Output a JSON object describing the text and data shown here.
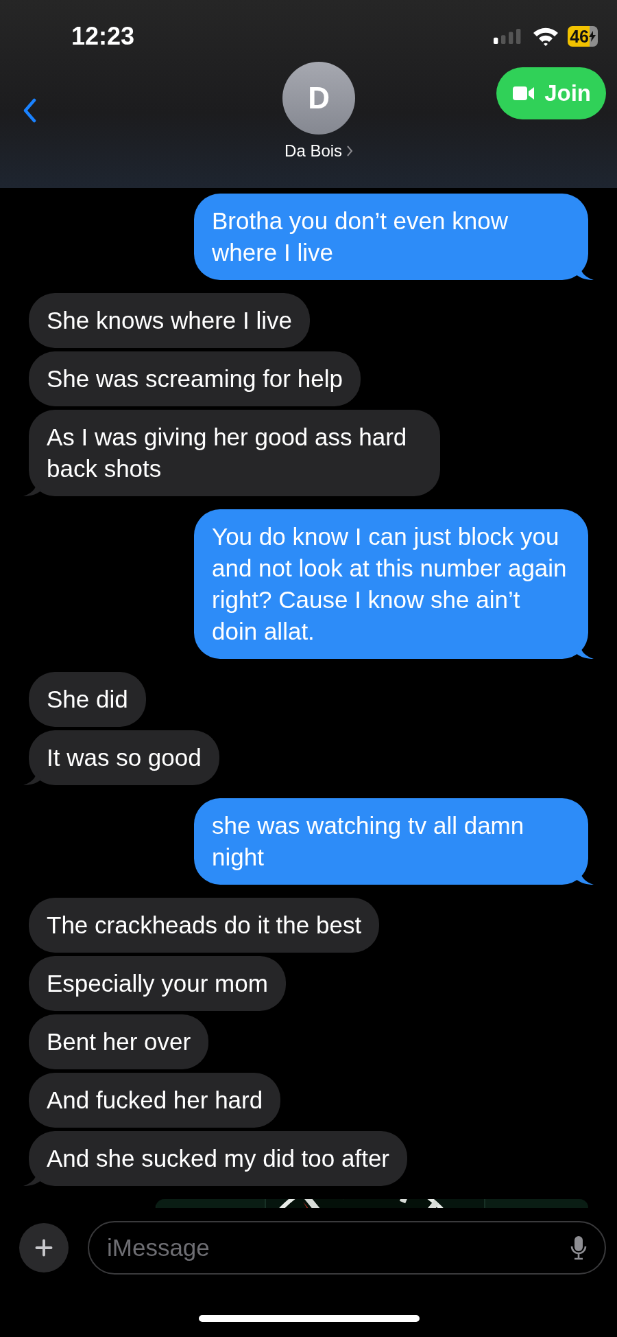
{
  "status_bar": {
    "time": "12:23",
    "battery": "46"
  },
  "header": {
    "avatar_letter": "D",
    "name": "Da Bois",
    "join": "Join"
  },
  "messages": [
    {
      "kind": "sent",
      "text": "Brotha you don’t even know where I live",
      "tail": true
    },
    {
      "kind": "received",
      "text": "She knows where I live",
      "tail": false
    },
    {
      "kind": "received",
      "text": "She was screaming for help",
      "tail": false
    },
    {
      "kind": "received",
      "text": "As I was giving her good ass hard back shots",
      "tail": true
    },
    {
      "kind": "sent",
      "text": "You do know I can just block you and not look at this number again right? Cause I know she ain’t doin allat.",
      "tail": true
    },
    {
      "kind": "received",
      "text": "She did",
      "tail": false
    },
    {
      "kind": "received",
      "text": "It was so good",
      "tail": true
    },
    {
      "kind": "sent",
      "text": "she was watching tv all damn night",
      "tail": true
    },
    {
      "kind": "received",
      "text": "The crackheads do it the best",
      "tail": false
    },
    {
      "kind": "received",
      "text": "Especially your mom",
      "tail": false
    },
    {
      "kind": "received",
      "text": "Bent her over",
      "tail": false
    },
    {
      "kind": "received",
      "text": "And fucked her hard",
      "tail": false
    },
    {
      "kind": "received",
      "text": "And she sucked my did too after",
      "tail": true
    },
    {
      "kind": "picture"
    }
  ],
  "composer": {
    "placeholder": "iMessage"
  }
}
